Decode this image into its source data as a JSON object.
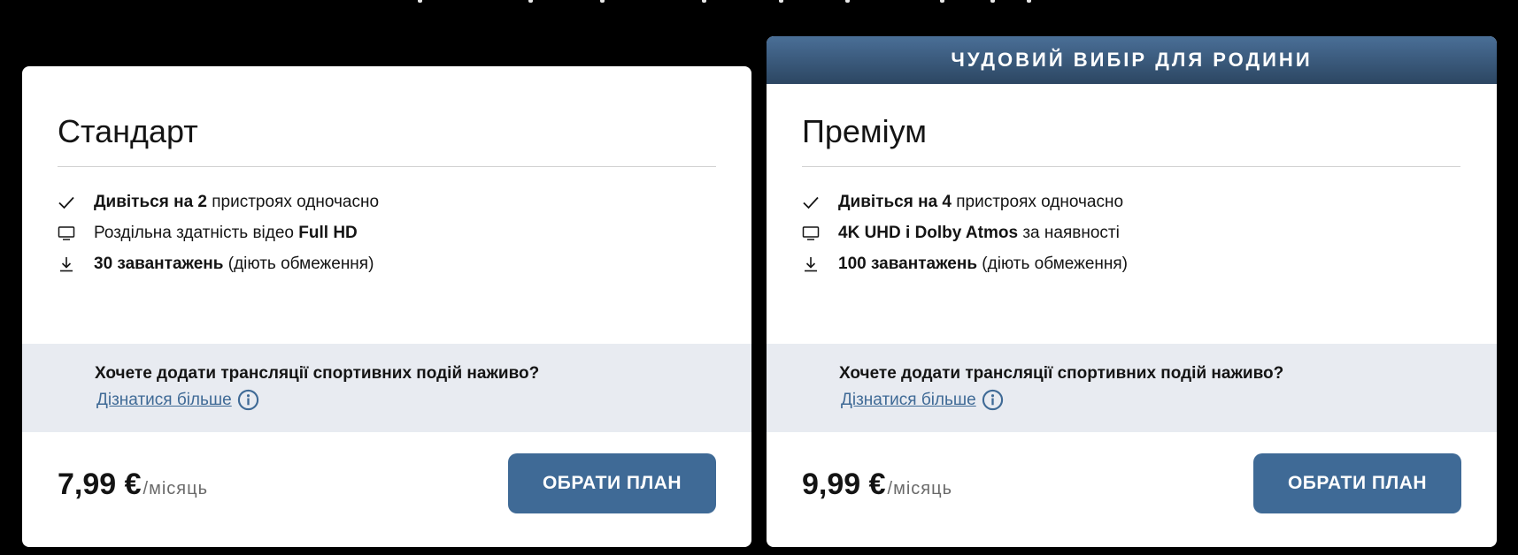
{
  "plans": [
    {
      "title": "Стандарт",
      "banner": "",
      "features": [
        {
          "icon": "check-icon",
          "bold": "Дивіться на 2",
          "text": " пристроях одночасно"
        },
        {
          "icon": "monitor-icon",
          "text": "Роздільна здатність відео ",
          "bold_after": "Full HD"
        },
        {
          "icon": "download-icon",
          "bold": "30 завантажень",
          "text": " (діють обмеження)"
        }
      ],
      "sports_question": "Хочете додати трансляції спортивних подій наживо?",
      "learn_more": "Дізнатися більше",
      "price": "7,99 €",
      "per": "/місяць",
      "button": "ОБРАТИ ПЛАН"
    },
    {
      "title": "Преміум",
      "banner": "ЧУДОВИЙ ВИБІР ДЛЯ РОДИНИ",
      "features": [
        {
          "icon": "check-icon",
          "bold": "Дивіться на 4",
          "text": " пристроях одночасно"
        },
        {
          "icon": "monitor-icon",
          "bold": "4K UHD і Dolby Atmos",
          "text": " за наявності"
        },
        {
          "icon": "download-icon",
          "bold": "100 завантажень",
          "text": " (діють обмеження)"
        }
      ],
      "sports_question": "Хочете додати трансляції спортивних подій наживо?",
      "learn_more": "Дізнатися більше",
      "price": "9,99 €",
      "per": "/місяць",
      "button": "ОБРАТИ ПЛАН"
    }
  ],
  "colors": {
    "page_background": "#000000",
    "card_background": "#ffffff",
    "accent": "#3f6a96",
    "banner_top": "#4a6f97",
    "banner_bottom": "#2c4662",
    "sports_band": "#e8ebf1"
  }
}
